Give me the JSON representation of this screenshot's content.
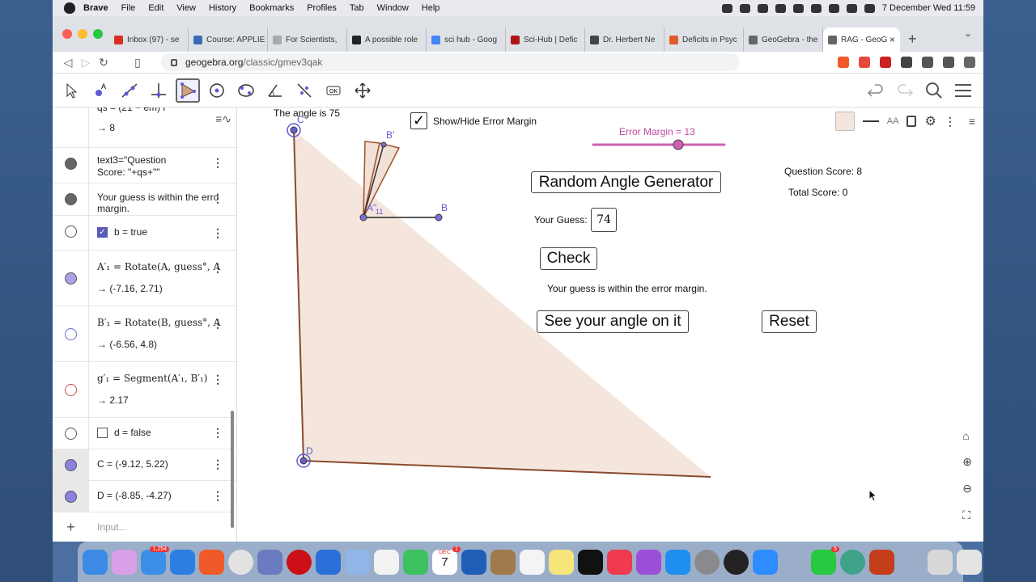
{
  "menubar": {
    "app": "Brave",
    "items": [
      "File",
      "Edit",
      "View",
      "History",
      "Bookmarks",
      "Profiles",
      "Tab",
      "Window",
      "Help"
    ],
    "datetime": "7 December Wed  11:59"
  },
  "tabs": [
    {
      "label": "Inbox (97) - se",
      "color": "#d93025"
    },
    {
      "label": "Course: APPLIE",
      "color": "#3b6bb5"
    },
    {
      "label": "For Scientists,",
      "color": "#aaaaaa"
    },
    {
      "label": "A possible role",
      "color": "#222222"
    },
    {
      "label": "sci hub - Goog",
      "color": "#4285f4"
    },
    {
      "label": "Sci-Hub | Defic",
      "color": "#b01515"
    },
    {
      "label": "Dr. Herbert Ne",
      "color": "#444444"
    },
    {
      "label": "Deficits in Psyc",
      "color": "#e05a2a"
    },
    {
      "label": "GeoGebra - the",
      "color": "#666666"
    },
    {
      "label": "RAG - GeoG",
      "color": "#666666",
      "active": true
    }
  ],
  "address": {
    "host": "geogebra.org",
    "path": "/classic/gmev3qak"
  },
  "algebra": {
    "r0_def": "qs = (21 − em) i",
    "r0_out": "→ 8",
    "r1_def1": "text3=\"Question",
    "r1_def2": "Score: \"+qs+\"\"",
    "r2_def1": "Your guess is within the erro",
    "r2_def2": "margin.",
    "r3_def": "b = true",
    "r4_def": "A′₁ = Rotate(A, guess°, A",
    "r4_out": "→ (-7.16, 2.71)",
    "r5_def": "B′₁ = Rotate(B, guess°, A",
    "r5_out": "→ (-6.56, 4.8)",
    "r6_def": "g′₁ = Segment(A′₁, B′₁)",
    "r6_out": "→ 2.17",
    "r7_def": "d = false",
    "r8_def": "C = (-9.12, 5.22)",
    "r9_def": "D = (-8.85, -4.27)",
    "input_placeholder": "Input..."
  },
  "graphics": {
    "angle_text": "The angle is 75",
    "show_hide_label": "Show/Hide Error Margin",
    "slider_label": "Error Margin = 13",
    "slider_value": 13,
    "random_btn": "Random Angle Generator",
    "your_guess_label": "Your Guess:",
    "guess_value": "74",
    "check_btn": "Check",
    "feedback": "Your guess is within the error margin.",
    "see_angle_btn": "See your angle on it",
    "reset_btn": "Reset",
    "question_score": "Question Score: 8",
    "total_score": "Total Score: 0",
    "labels": {
      "C": "C",
      "D": "D",
      "A2": "A\"",
      "B": "B",
      "B1": "B'",
      "small": "11"
    }
  },
  "dock_badges": {
    "mail": "1,254",
    "calendar": "1",
    "whatsapp": "5"
  },
  "calendar": {
    "month": "DEC",
    "day": "7"
  },
  "colors": {
    "accent": "#7c6fd9",
    "slider": "#d060b0",
    "triangle_fill": "#f4e6dc",
    "triangle_edge": "#8b4a2e"
  }
}
